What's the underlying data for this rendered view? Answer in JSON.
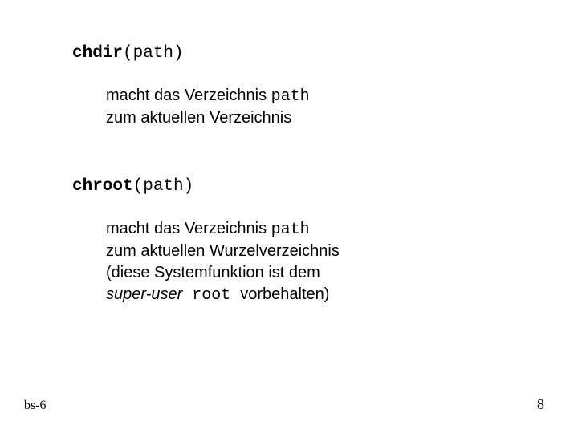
{
  "sections": [
    {
      "func_bold": "chdir",
      "func_rest": "(path)",
      "desc_pre1": "macht das Verzeichnis ",
      "desc_code1": "path",
      "desc_line2a": "zum aktuellen Verzeichnis",
      "desc_line3a": "",
      "desc_line4a_italic": "",
      "desc_line4a_code": "",
      "desc_line4b": ""
    },
    {
      "func_bold": "chroot",
      "func_rest": "(path)",
      "desc_pre1": "macht das Verzeichnis ",
      "desc_code1": "path",
      "desc_line2a": "zum aktuellen Wurzelverzeichnis",
      "desc_line3a": "(diese Systemfunktion ist dem",
      "desc_line4a_italic": "super-user",
      "desc_line4a_code": " root ",
      "desc_line4b": " vorbehalten)"
    }
  ],
  "footer": {
    "left": "bs-6",
    "right": "8"
  }
}
